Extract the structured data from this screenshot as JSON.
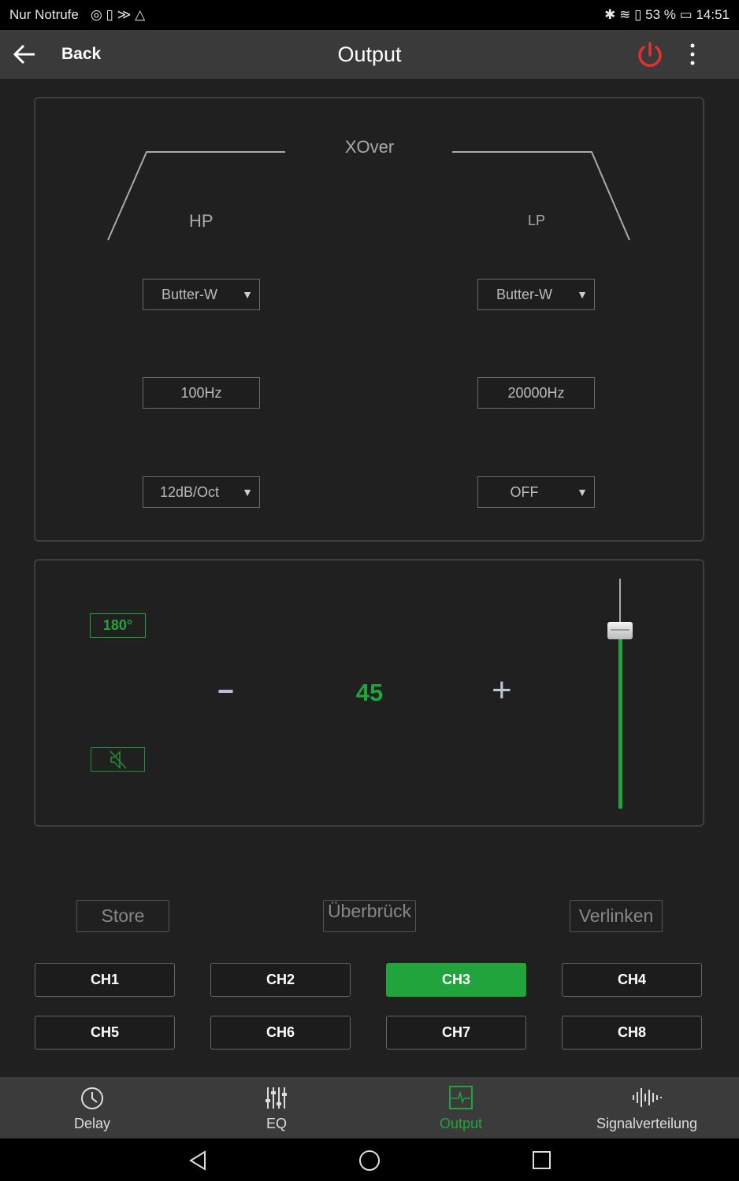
{
  "status_bar": {
    "left_text": "Nur Notrufe",
    "battery": "53 %",
    "time": "14:51"
  },
  "header": {
    "back_label": "Back",
    "title": "Output",
    "power_color": "#e53030"
  },
  "xover": {
    "title": "XOver",
    "hp": {
      "label": "HP",
      "type": "Butter-W",
      "freq": "100Hz",
      "slope": "12dB/Oct"
    },
    "lp": {
      "label": "LP",
      "type": "Butter-W",
      "freq": "20000Hz",
      "slope": "OFF"
    }
  },
  "gain": {
    "phase_label": "180°",
    "value": "45",
    "minus": "−",
    "plus": "+",
    "slider_level_fraction": 0.76,
    "accent": "#22a43c"
  },
  "actions": {
    "store": "Store",
    "bridge": "Überbrück",
    "link": "Verlinken"
  },
  "channels": [
    {
      "label": "CH1"
    },
    {
      "label": "CH2"
    },
    {
      "label": "CH3",
      "active": true
    },
    {
      "label": "CH4"
    },
    {
      "label": "CH5"
    },
    {
      "label": "CH6"
    },
    {
      "label": "CH7"
    },
    {
      "label": "CH8"
    }
  ],
  "nav": [
    {
      "label": "Delay",
      "icon": "clock-icon"
    },
    {
      "label": "EQ",
      "icon": "sliders-icon"
    },
    {
      "label": "Output",
      "icon": "output-icon",
      "active": true
    },
    {
      "label": "Signalverteilung",
      "icon": "waveform-icon"
    }
  ]
}
